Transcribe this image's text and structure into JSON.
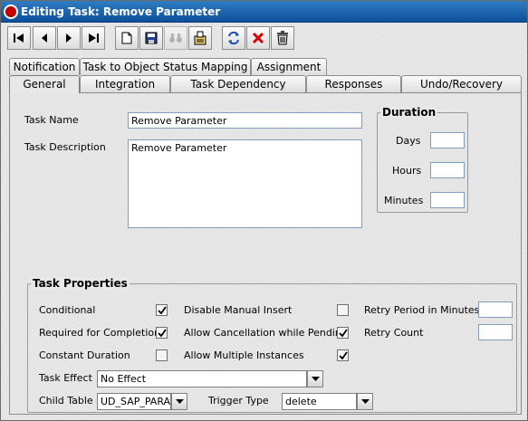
{
  "window": {
    "title": "Editing Task: Remove Parameter"
  },
  "toolbar": {
    "buttons": [
      {
        "name": "first-record-button",
        "icon": "first-icon"
      },
      {
        "name": "previous-record-button",
        "icon": "previous-icon"
      },
      {
        "name": "next-record-button",
        "icon": "next-icon"
      },
      {
        "name": "last-record-button",
        "icon": "last-icon"
      },
      {
        "name": "new-button",
        "icon": "new-document-icon"
      },
      {
        "name": "save-button",
        "icon": "save-icon"
      },
      {
        "name": "find-button",
        "icon": "binoculars-icon"
      },
      {
        "name": "query-button",
        "icon": "query-icon"
      },
      {
        "name": "refresh-button",
        "icon": "refresh-icon"
      },
      {
        "name": "cancel-button",
        "icon": "delete-x-icon"
      },
      {
        "name": "delete-button",
        "icon": "trash-icon"
      }
    ]
  },
  "tabs": {
    "row1": [
      "Notification",
      "Task to Object Status Mapping",
      "Assignment"
    ],
    "row2": [
      "General",
      "Integration",
      "Task Dependency",
      "Responses",
      "Undo/Recovery"
    ],
    "selected": "General"
  },
  "general": {
    "task_name_label": "Task Name",
    "task_name_value": "Remove Parameter",
    "task_description_label": "Task Description",
    "task_description_value": "Remove Parameter"
  },
  "duration": {
    "title": "Duration",
    "days_label": "Days",
    "hours_label": "Hours",
    "minutes_label": "Minutes",
    "days_value": "",
    "hours_value": "",
    "minutes_value": ""
  },
  "task_properties": {
    "title": "Task Properties",
    "conditional_label": "Conditional",
    "conditional_checked": true,
    "required_label": "Required for Completion",
    "required_checked": true,
    "constant_duration_label": "Constant Duration",
    "constant_duration_checked": false,
    "disable_manual_insert_label": "Disable Manual Insert",
    "disable_manual_insert_checked": false,
    "allow_cancellation_label": "Allow Cancellation while Pending",
    "allow_cancellation_checked": true,
    "allow_multiple_label": "Allow Multiple Instances",
    "allow_multiple_checked": true,
    "retry_period_label": "Retry Period in Minutes",
    "retry_period_value": "",
    "retry_count_label": "Retry Count",
    "retry_count_value": "",
    "task_effect_label": "Task Effect",
    "task_effect_value": "No Effect",
    "child_table_label": "Child Table",
    "child_table_value": "UD_SAP_PARA",
    "trigger_type_label": "Trigger Type",
    "trigger_type_value": "delete"
  },
  "colors": {
    "titlebar": "#1a5fa8",
    "cancel_red": "#d40000",
    "field_border": "#7f9db9"
  }
}
